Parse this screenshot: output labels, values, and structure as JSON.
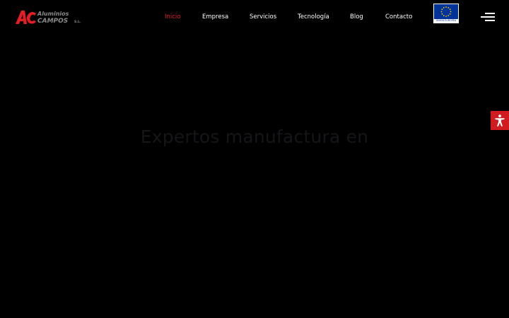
{
  "header": {
    "logo": {
      "mark": "AC",
      "line1": "Aluminios",
      "line2": "CAMPOS",
      "suffix": "S.L."
    },
    "nav": [
      {
        "label": "Inicio",
        "active": true
      },
      {
        "label": "Empresa",
        "active": false
      },
      {
        "label": "Servicios",
        "active": false
      },
      {
        "label": "Tecnología",
        "active": false
      },
      {
        "label": "Blog",
        "active": false
      },
      {
        "label": "Contacto",
        "active": false
      }
    ],
    "eu_badge": {
      "caption": "UNIÓN EUROPEA"
    },
    "menu_icon": "hamburger-icon"
  },
  "hero": {
    "title": "Expertos manufactura en"
  },
  "accessibility": {
    "icon": "accessibility-icon"
  },
  "colors": {
    "background": "#000000",
    "accent": "#e31e24",
    "nav_text": "#ffffff",
    "hero_text": "#15151a",
    "eu_blue": "#003399",
    "eu_star": "#ffcc00"
  }
}
